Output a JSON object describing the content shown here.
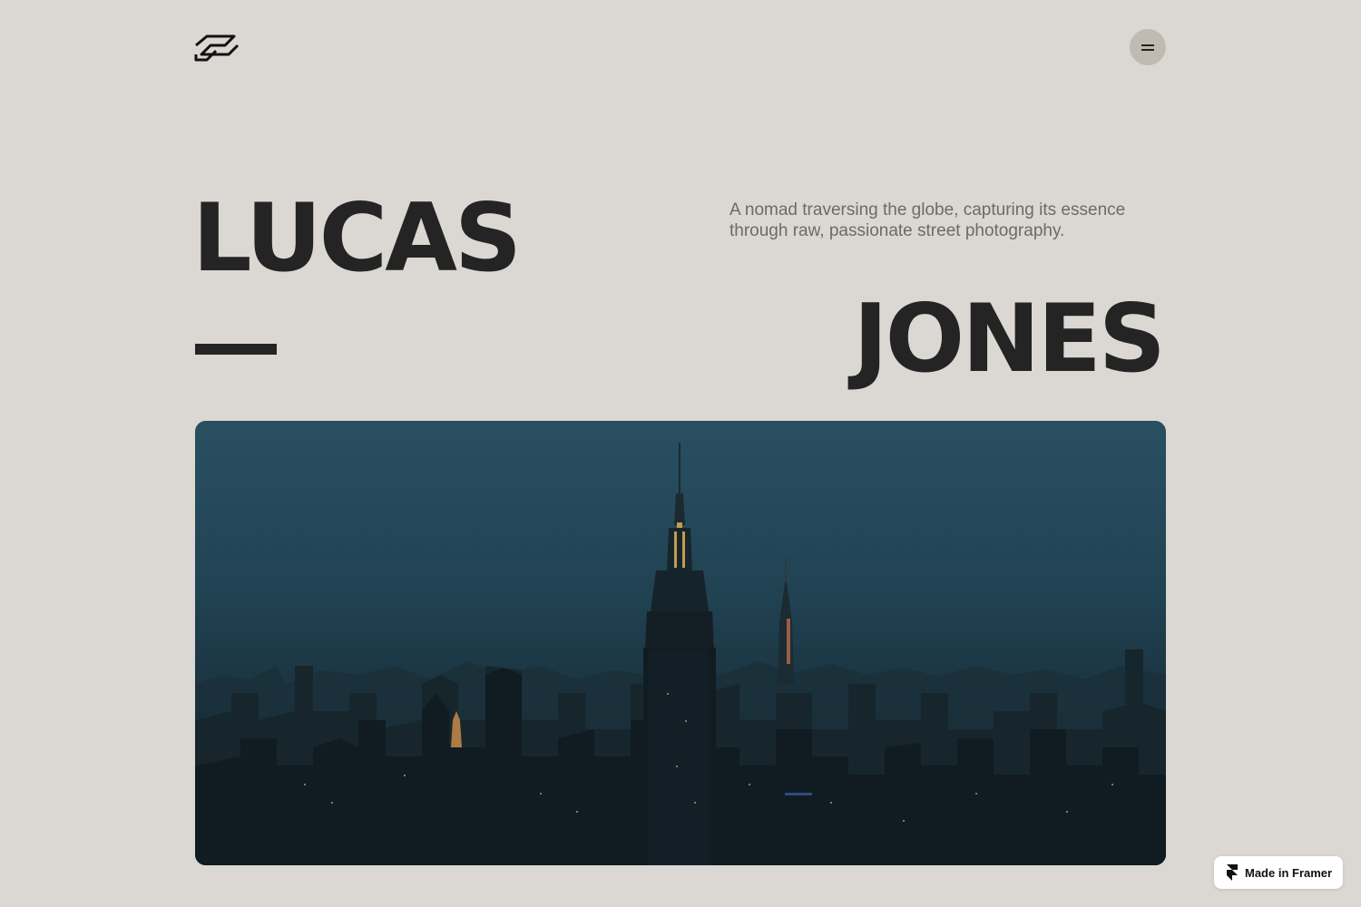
{
  "header": {
    "logo_icon": "wave-logo-icon",
    "menu_icon": "hamburger-menu-icon"
  },
  "hero": {
    "first_name": "LUCAS",
    "last_name": "JONES",
    "tagline": "A nomad traversing the globe, capturing its essence through raw, passionate street photography.",
    "image_subject": "city-skyline-photo"
  },
  "badge": {
    "label": "Made in Framer",
    "icon": "framer-icon"
  },
  "colors": {
    "background": "#dbd8d3",
    "heading": "#242424",
    "tagline": "#6e6a65",
    "menu_button": "#bfbab2"
  }
}
